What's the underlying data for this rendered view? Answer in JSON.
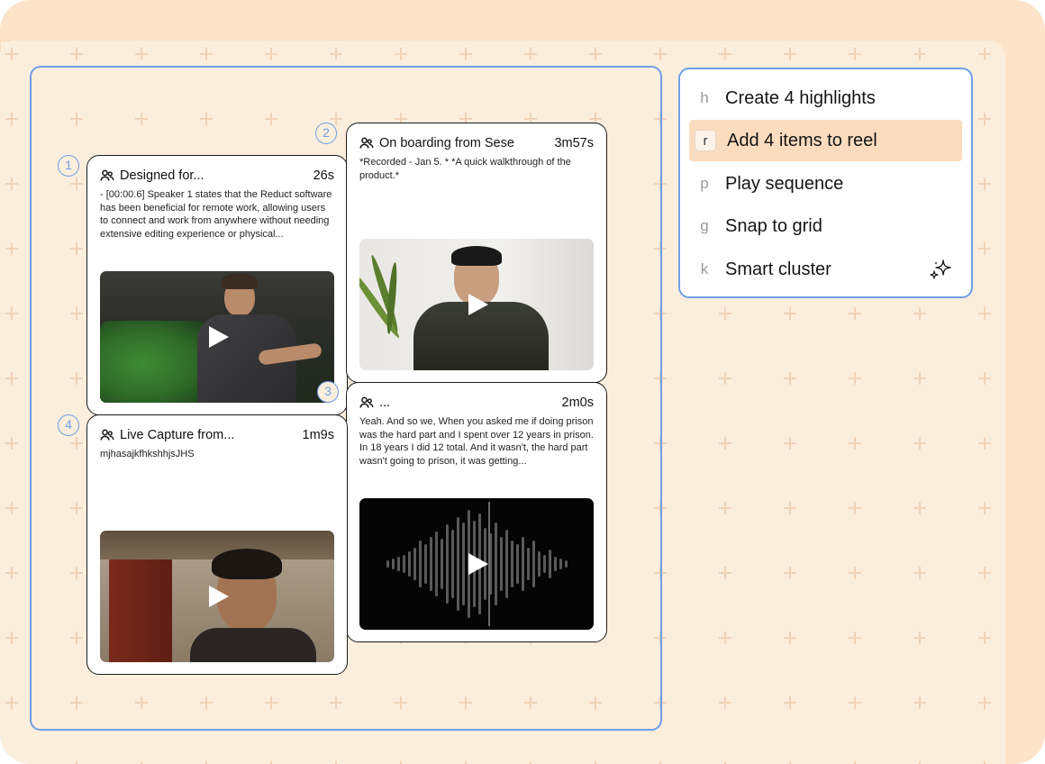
{
  "selection_badges": [
    "1",
    "2",
    "3",
    "4"
  ],
  "cards": [
    {
      "title": "Designed for...",
      "duration": "26s",
      "description": "- [00:00.6] Speaker 1 states that the Reduct software has been beneficial for remote work, allowing users to connect and work from anywhere without needing extensive editing experience or physical...",
      "thumbnail": "man on green couch"
    },
    {
      "title": "On boarding from Sese",
      "duration": "3m57s",
      "description": "*Recorded - Jan 5. * *A quick walkthrough of the product.*",
      "thumbnail": "man with glasses and plant"
    },
    {
      "title": "...",
      "duration": "2m0s",
      "description": "Yeah. And so we, When you asked me if doing prison was the hard part and I spent over 12 years in prison. In 18 years I did 12 total. And it wasn't, the hard part wasn't going to prison, it was getting...",
      "thumbnail": "audio waveform"
    },
    {
      "title": "Live Capture from...",
      "duration": "1m9s",
      "description": "mjhasajkfhkshhjsJHS",
      "thumbnail": "man in room"
    }
  ],
  "menu": {
    "items": [
      {
        "key": "h",
        "label": "Create 4 highlights"
      },
      {
        "key": "r",
        "label": "Add 4 items to reel"
      },
      {
        "key": "p",
        "label": "Play sequence"
      },
      {
        "key": "g",
        "label": "Snap to grid"
      },
      {
        "key": "k",
        "label": "Smart cluster"
      }
    ]
  },
  "colors": {
    "accent": "#6f9fe6",
    "active_item": "#fbdcbf",
    "canvas": "#fbeedd",
    "frame": "#fde3c8"
  }
}
